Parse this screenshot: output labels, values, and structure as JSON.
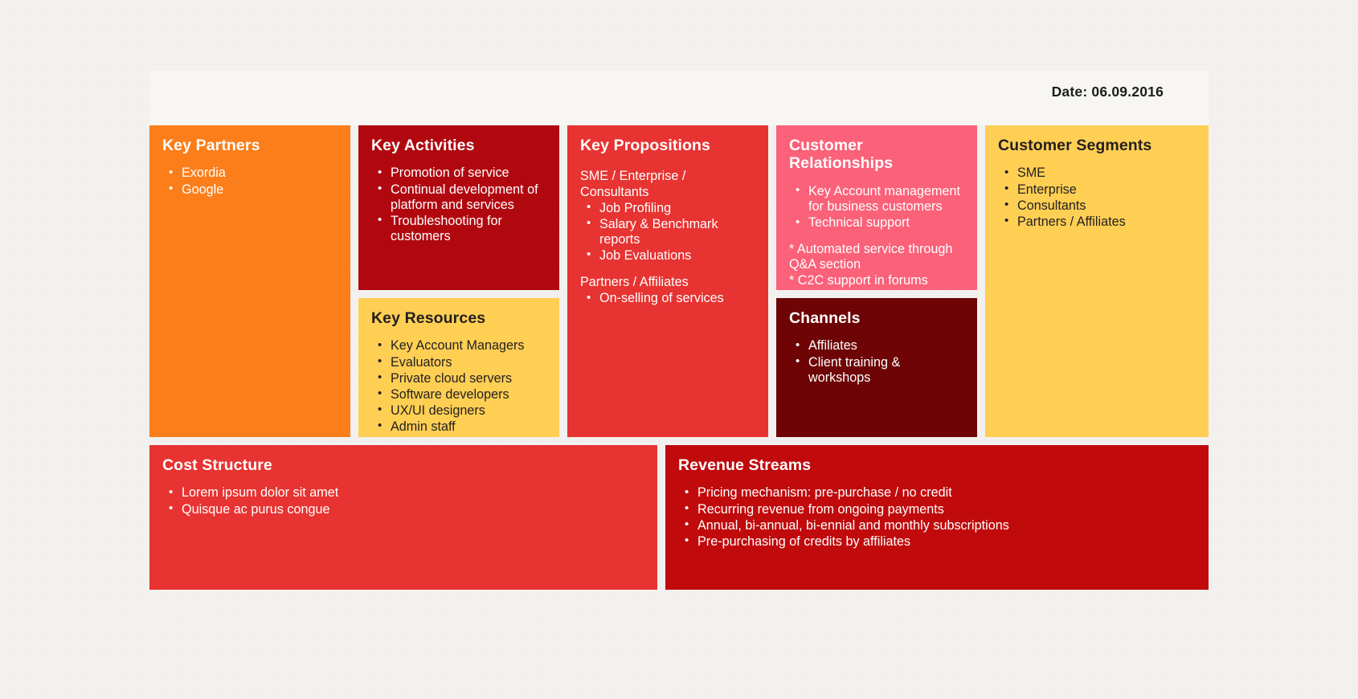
{
  "header": {
    "date_label": "Date: 06.09.2016"
  },
  "colors": {
    "background": "#f2f1ef",
    "header_band": "#f7f6f3",
    "orange": "#fb7e1a",
    "dark_red": "#b10810",
    "red": "#e73331",
    "pink": "#fb6179",
    "yellow": "#ffcf54",
    "maroon": "#6e0405",
    "crimson": "#c00a0c",
    "white_text": "#ffffff",
    "dark_text": "#231f20"
  },
  "blocks": {
    "key_partners": {
      "title": "Key Partners",
      "items": [
        "Exordia",
        "Google"
      ]
    },
    "key_activities": {
      "title": "Key Activities",
      "items": [
        "Promotion of service",
        "Continual development of platform and services",
        "Troubleshooting for customers"
      ]
    },
    "key_resources": {
      "title": "Key Resources",
      "items": [
        "Key Account Managers",
        "Evaluators",
        "Private cloud servers",
        "Software developers",
        "UX/UI designers",
        "Admin staff"
      ]
    },
    "key_propositions": {
      "title": "Key Propositions",
      "group_one_heading": "SME / Enterprise / Consultants",
      "group_one_items": [
        "Job Profiling",
        "Salary & Benchmark reports",
        "Job Evaluations"
      ],
      "group_two_heading": "Partners / Affiliates",
      "group_two_items": [
        "On-selling of services"
      ]
    },
    "customer_relationships": {
      "title": "Customer Relationships",
      "items": [
        "Key Account management for business customers",
        "Technical support"
      ],
      "notes": [
        "* Automated service through Q&A section",
        "* C2C support in forums"
      ]
    },
    "channels": {
      "title": "Channels",
      "items": [
        "Affiliates",
        "Client training & workshops"
      ]
    },
    "customer_segments": {
      "title": "Customer Segments",
      "items": [
        "SME",
        "Enterprise",
        "Consultants",
        "Partners / Affiliates"
      ]
    },
    "cost_structure": {
      "title": "Cost Structure",
      "items": [
        "Lorem ipsum dolor sit amet",
        "Quisque ac purus congue"
      ]
    },
    "revenue_streams": {
      "title": "Revenue Streams",
      "items": [
        "Pricing mechanism: pre-purchase / no credit",
        "Recurring revenue from ongoing payments",
        "Annual, bi-annual, bi-ennial and monthly subscriptions",
        "Pre-purchasing of credits by affiliates"
      ]
    }
  }
}
